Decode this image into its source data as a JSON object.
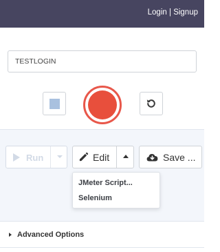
{
  "header": {
    "login_label": "Login",
    "separator": "|",
    "signup_label": "Signup",
    "background_color": "#474560"
  },
  "recorder": {
    "test_name_value": "TESTLOGIN",
    "stop_icon": "stop-square-icon",
    "record_icon": "record-circle-icon",
    "reset_icon": "undo-icon",
    "record_color": "#e84f3c"
  },
  "toolbar": {
    "run_label": "Run",
    "run_icon": "play-icon",
    "edit_label": "Edit",
    "edit_icon": "pencil-icon",
    "save_label": "Save ...",
    "save_icon": "cloud-download-icon"
  },
  "edit_menu": {
    "items": [
      "JMeter Script...",
      "Selenium"
    ]
  },
  "advanced": {
    "label": "Advanced Options"
  }
}
